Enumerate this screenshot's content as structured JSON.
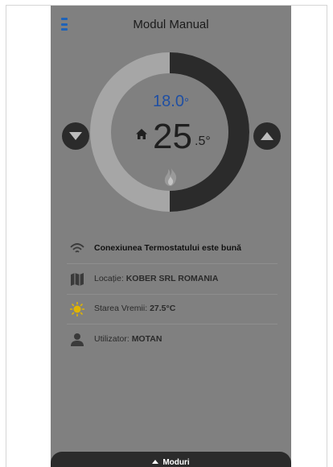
{
  "header": {
    "title": "Modul Manual",
    "menu_icon": "hamburger-menu-icon"
  },
  "thermostat": {
    "set_value": "18.0",
    "set_unit": "°",
    "current_value_int": "25",
    "current_value_dec": ".5°",
    "heating_progress": 0.5,
    "colors": {
      "ring_filled": "#2b2b2b",
      "ring_track": "#a6a6a6",
      "set_temp": "#1f4fa3",
      "background": "#808080"
    }
  },
  "info_rows": [
    {
      "icon": "wifi-icon",
      "label": "Conexiunea Termostatului este bună",
      "value": ""
    },
    {
      "icon": "map-icon",
      "label": "Locație: ",
      "value": "KOBER SRL ROMANIA"
    },
    {
      "icon": "sun-icon",
      "label": "Starea Vremii: ",
      "value": "27.5°C"
    },
    {
      "icon": "user-icon",
      "label": "Utilizator: ",
      "value": "MOTAN"
    }
  ],
  "bottom_bar": {
    "label": "Moduri"
  }
}
